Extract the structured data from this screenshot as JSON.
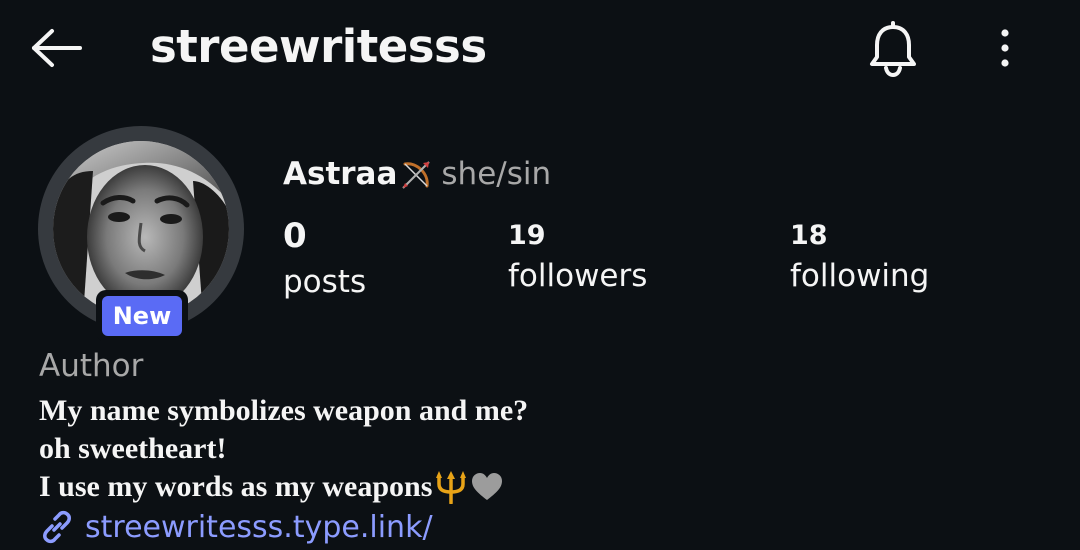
{
  "header": {
    "username": "streewritesss",
    "back_icon": "arrow-left-icon",
    "notification_icon": "bell-icon",
    "more_icon": "more-vertical-icon"
  },
  "profile": {
    "display_name": "Astraa",
    "name_emoji": "bow-and-arrow-icon",
    "pronouns": "she/sin",
    "badge": "New",
    "badge_color": "#5a6bf5"
  },
  "stats": {
    "posts": {
      "count": "0",
      "label": "posts"
    },
    "followers": {
      "count": "19",
      "label": "followers"
    },
    "following": {
      "count": "18",
      "label": "following"
    }
  },
  "bio": {
    "category": "Author",
    "lines": [
      "My name symbolizes weapon and me?",
      "oh sweetheart!",
      "I use my words as my weapons"
    ],
    "line3_emojis": [
      "trident-icon",
      "grey-heart-icon"
    ],
    "link_icon": "link-icon",
    "link": "streewritesss.type.link/",
    "link_color": "#8c9cff"
  },
  "colors": {
    "background": "#0c1014",
    "text": "#f5f5f5",
    "secondary_text": "#a8a8a8"
  }
}
